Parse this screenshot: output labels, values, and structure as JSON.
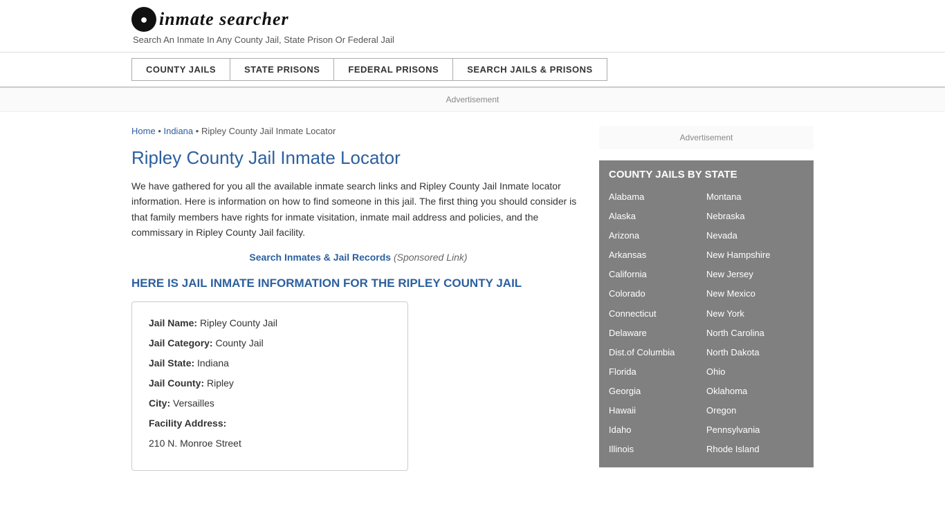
{
  "header": {
    "logo_text": "inmate searcher",
    "tagline": "Search An Inmate In Any County Jail, State Prison Or Federal Jail"
  },
  "nav": {
    "buttons": [
      {
        "label": "COUNTY JAILS"
      },
      {
        "label": "STATE PRISONS"
      },
      {
        "label": "FEDERAL PRISONS"
      },
      {
        "label": "SEARCH JAILS & PRISONS"
      }
    ]
  },
  "ad_banner": "Advertisement",
  "breadcrumb": {
    "home": "Home",
    "state": "Indiana",
    "current": "Ripley County Jail Inmate Locator"
  },
  "page_title": "Ripley County Jail Inmate Locator",
  "description": "We have gathered for you all the available inmate search links and Ripley County Jail Inmate locator information. Here is information on how to find someone in this jail. The first thing you should consider is that family members have rights for inmate visitation, inmate mail address and policies, and the commissary in Ripley County Jail facility.",
  "sponsored": {
    "link_text": "Search Inmates & Jail Records",
    "suffix": "(Sponsored Link)"
  },
  "section_heading": "HERE IS JAIL INMATE INFORMATION FOR THE RIPLEY COUNTY JAIL",
  "jail_info": {
    "name_label": "Jail Name:",
    "name_value": "Ripley County Jail",
    "category_label": "Jail Category:",
    "category_value": "County Jail",
    "state_label": "Jail State:",
    "state_value": "Indiana",
    "county_label": "Jail County:",
    "county_value": "Ripley",
    "city_label": "City:",
    "city_value": "Versailles",
    "address_label": "Facility Address:",
    "address_value": "210 N. Monroe Street"
  },
  "sidebar": {
    "ad_text": "Advertisement",
    "county_jails_title": "COUNTY JAILS BY STATE",
    "states_left": [
      "Alabama",
      "Alaska",
      "Arizona",
      "Arkansas",
      "California",
      "Colorado",
      "Connecticut",
      "Delaware",
      "Dist.of Columbia",
      "Florida",
      "Georgia",
      "Hawaii",
      "Idaho",
      "Illinois"
    ],
    "states_right": [
      "Montana",
      "Nebraska",
      "Nevada",
      "New Hampshire",
      "New Jersey",
      "New Mexico",
      "New York",
      "North Carolina",
      "North Dakota",
      "Ohio",
      "Oklahoma",
      "Oregon",
      "Pennsylvania",
      "Rhode Island"
    ]
  }
}
